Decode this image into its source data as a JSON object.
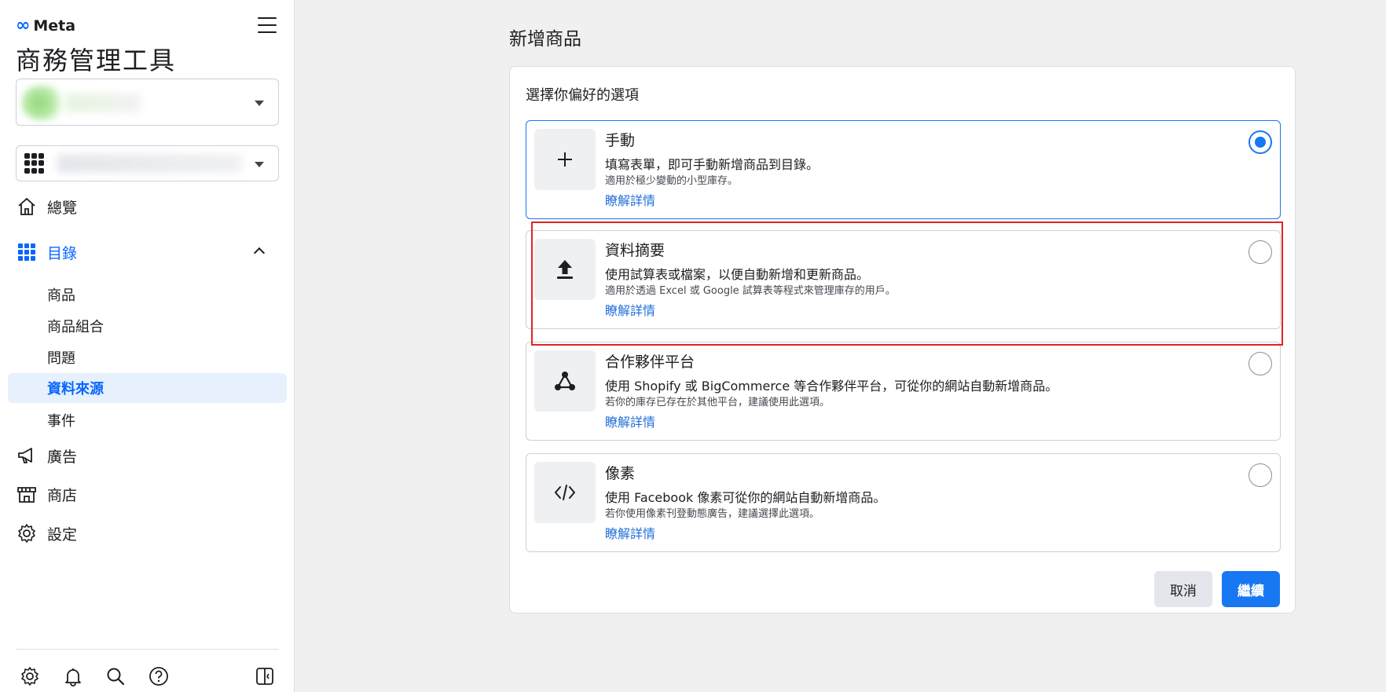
{
  "brand": {
    "logo_text": "Meta",
    "accent": "#0866ff",
    "highlight": "#e02424"
  },
  "sidebar": {
    "title": "商務管理工具",
    "nav": [
      {
        "label": "總覽",
        "icon": "home-icon"
      },
      {
        "label": "目錄",
        "icon": "grid-icon"
      },
      {
        "label": "廣告",
        "icon": "megaphone-icon"
      },
      {
        "label": "商店",
        "icon": "storefront-icon"
      },
      {
        "label": "設定",
        "icon": "gear-icon"
      }
    ],
    "catalog_sub": [
      "商品",
      "商品組合",
      "問題",
      "資料來源",
      "事件"
    ],
    "active_sub": "資料來源",
    "bottom_icons": [
      "gear-icon",
      "bell-icon",
      "search-icon",
      "help-icon",
      "panel-toggle-icon"
    ]
  },
  "main": {
    "page_title": "新增商品",
    "card_subtitle": "選擇你偏好的選項",
    "options": [
      {
        "title": "手動",
        "desc": "填寫表單，即可手動新增商品到目錄。",
        "note": "適用於極少變動的小型庫存。",
        "link": "瞭解詳情",
        "icon": "plus-icon",
        "selected": true
      },
      {
        "title": "資料摘要",
        "desc": "使用試算表或檔案，以便自動新增和更新商品。",
        "note": "適用於透過 Excel 或 Google 試算表等程式來管理庫存的用戶。",
        "link": "瞭解詳情",
        "icon": "upload-icon",
        "selected": false
      },
      {
        "title": "合作夥伴平台",
        "desc": "使用 Shopify 或 BigCommerce 等合作夥伴平台，可從你的網站自動新增商品。",
        "note": "若你的庫存已存在於其他平台，建議使用此選項。",
        "link": "瞭解詳情",
        "icon": "share-nodes-icon",
        "selected": false
      },
      {
        "title": "像素",
        "desc": "使用 Facebook 像素可從你的網站自動新增商品。",
        "note": "若你使用像素刊登動態廣告，建議選擇此選項。",
        "link": "瞭解詳情",
        "icon": "code-icon",
        "selected": false
      }
    ],
    "cancel_label": "取消",
    "continue_label": "繼續"
  }
}
